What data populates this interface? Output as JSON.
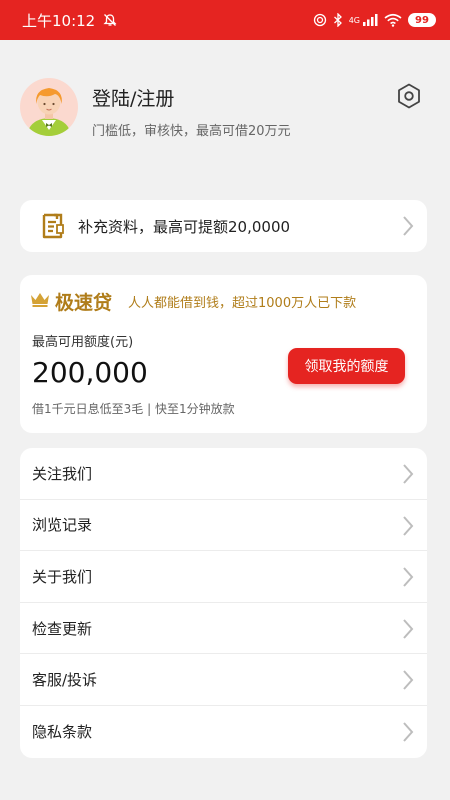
{
  "status_bar": {
    "time": "上午10:12",
    "battery": "99",
    "network": "4G"
  },
  "profile": {
    "title": "登陆/注册",
    "subtitle": "门槛低，审核快，最高可借20万元"
  },
  "supplement": {
    "text": "补充资料，最高可提额20,0000"
  },
  "loan": {
    "name": "极速贷",
    "slogan": "人人都能借到钱，超过1000万人已下款",
    "limit_label": "最高可用额度(元)",
    "amount": "200,000",
    "button": "领取我的额度",
    "note": "借1千元日息低至3毛 | 快至1分钟放款"
  },
  "menu": [
    {
      "label": "关注我们"
    },
    {
      "label": "浏览记录"
    },
    {
      "label": "关于我们"
    },
    {
      "label": "检查更新"
    },
    {
      "label": "客服/投诉"
    },
    {
      "label": "隐私条款"
    }
  ],
  "colors": {
    "accent": "#e52421",
    "gold": "#b07d1a",
    "background": "#f1f1f1"
  },
  "icons": [
    "mute-icon",
    "hotspot-icon",
    "bluetooth-icon",
    "signal-icon",
    "wifi-icon",
    "battery-icon",
    "avatar",
    "settings-icon",
    "document-icon",
    "crown-icon",
    "chevron-right-icon"
  ]
}
